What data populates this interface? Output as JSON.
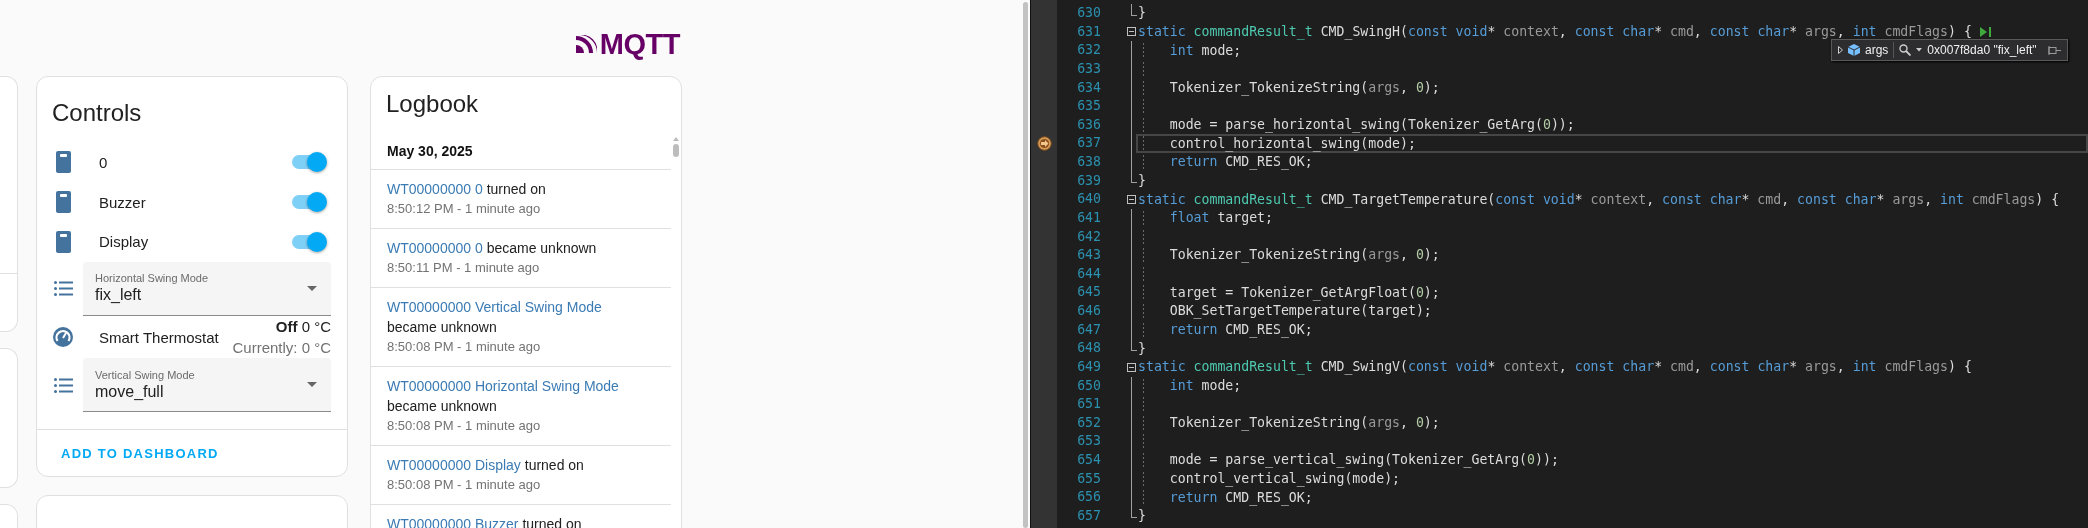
{
  "logo": {
    "text": "MQTT"
  },
  "controls": {
    "title": "Controls",
    "rows": [
      {
        "kind": "switch",
        "name": "0",
        "on": true
      },
      {
        "kind": "switch",
        "name": "Buzzer",
        "on": true
      },
      {
        "kind": "switch",
        "name": "Display",
        "on": true
      },
      {
        "kind": "select",
        "label": "Horizontal Swing Mode",
        "value": "fix_left"
      },
      {
        "kind": "climate",
        "name": "Smart Thermostat",
        "state": "**Off** 0 °C",
        "current": "Currently: 0 °C"
      },
      {
        "kind": "select",
        "label": "Vertical Swing Mode",
        "value": "move_full"
      }
    ],
    "action": "ADD TO DASHBOARD"
  },
  "logbook": {
    "title": "Logbook",
    "date": "May 30, 2025",
    "entries": [
      {
        "entity": "WT00000000 0",
        "action": "turned on",
        "time": "8:50:12 PM - 1 minute ago"
      },
      {
        "entity": "WT00000000 0",
        "action": "became unknown",
        "time": "8:50:11 PM - 1 minute ago"
      },
      {
        "entity": "WT00000000 Vertical Swing Mode",
        "action": "became unknown",
        "time": "8:50:08 PM - 1 minute ago"
      },
      {
        "entity": "WT00000000 Horizontal Swing Mode",
        "action": "became unknown",
        "time": "8:50:08 PM - 1 minute ago"
      },
      {
        "entity": "WT00000000 Display",
        "action": "turned on",
        "time": "8:50:08 PM - 1 minute ago"
      },
      {
        "entity": "WT00000000 Buzzer",
        "action": "turned on"
      }
    ]
  },
  "editor": {
    "datatip": {
      "name": "args",
      "value": "0x007f8da0 \"fix_left\""
    },
    "lines": [
      {
        "number": "630",
        "kind": "close",
        "current": false,
        "run_to_click": false,
        "tokens": [
          {
            "kind": "plain",
            "text": "}"
          }
        ]
      },
      {
        "number": "631",
        "kind": "open",
        "current": false,
        "run_to_click": true,
        "tokens": [
          {
            "kind": "keyword",
            "text": "static "
          },
          {
            "kind": "type",
            "text": "commandResult_t "
          },
          {
            "kind": "plain",
            "text": "CMD_SwingH("
          },
          {
            "kind": "keyword",
            "text": "const void"
          },
          {
            "kind": "plain",
            "text": "* "
          },
          {
            "kind": "param",
            "text": "context"
          },
          {
            "kind": "plain",
            "text": ", "
          },
          {
            "kind": "keyword",
            "text": "const char"
          },
          {
            "kind": "plain",
            "text": "* "
          },
          {
            "kind": "param",
            "text": "cmd"
          },
          {
            "kind": "plain",
            "text": ", "
          },
          {
            "kind": "keyword",
            "text": "const char"
          },
          {
            "kind": "plain",
            "text": "* "
          },
          {
            "kind": "param",
            "text": "args"
          },
          {
            "kind": "plain",
            "text": ", "
          },
          {
            "kind": "keyword",
            "text": "int "
          },
          {
            "kind": "param",
            "text": "cmdFlags"
          },
          {
            "kind": "plain",
            "text": ") {"
          }
        ]
      },
      {
        "number": "632",
        "kind": "body",
        "current": false,
        "run_to_click": false,
        "tokens": [
          {
            "kind": "keyword",
            "text": "    int "
          },
          {
            "kind": "plain",
            "text": "mode;"
          }
        ]
      },
      {
        "number": "633",
        "kind": "body",
        "current": false,
        "run_to_click": false
      },
      {
        "number": "634",
        "kind": "body",
        "current": false,
        "run_to_click": false,
        "tokens": [
          {
            "kind": "plain",
            "text": "    Tokenizer_TokenizeString("
          },
          {
            "kind": "param",
            "text": "args"
          },
          {
            "kind": "plain",
            "text": ", "
          },
          {
            "kind": "number",
            "text": "0"
          },
          {
            "kind": "plain",
            "text": ");"
          }
        ]
      },
      {
        "number": "635",
        "kind": "body",
        "current": false,
        "run_to_click": false
      },
      {
        "number": "636",
        "kind": "body",
        "current": false,
        "run_to_click": false,
        "tokens": [
          {
            "kind": "plain",
            "text": "    mode = parse_horizontal_swing(Tokenizer_GetArg("
          },
          {
            "kind": "number",
            "text": "0"
          },
          {
            "kind": "plain",
            "text": "));"
          }
        ]
      },
      {
        "number": "637",
        "kind": "body",
        "current": true,
        "run_to_click": false,
        "tokens": [
          {
            "kind": "plain",
            "text": "    control_horizontal_swing(mode);"
          }
        ]
      },
      {
        "number": "638",
        "kind": "body",
        "current": false,
        "run_to_click": false,
        "tokens": [
          {
            "kind": "keyword",
            "text": "    return "
          },
          {
            "kind": "plain",
            "text": "CMD_RES_OK;"
          }
        ]
      },
      {
        "number": "639",
        "kind": "close",
        "current": false,
        "run_to_click": false,
        "tokens": [
          {
            "kind": "plain",
            "text": "}"
          }
        ]
      },
      {
        "number": "640",
        "kind": "open",
        "current": false,
        "run_to_click": false,
        "tokens": [
          {
            "kind": "keyword",
            "text": "static "
          },
          {
            "kind": "type",
            "text": "commandResult_t "
          },
          {
            "kind": "plain",
            "text": "CMD_TargetTemperature("
          },
          {
            "kind": "keyword",
            "text": "const void"
          },
          {
            "kind": "plain",
            "text": "* "
          },
          {
            "kind": "param",
            "text": "context"
          },
          {
            "kind": "plain",
            "text": ", "
          },
          {
            "kind": "keyword",
            "text": "const char"
          },
          {
            "kind": "plain",
            "text": "* "
          },
          {
            "kind": "param",
            "text": "cmd"
          },
          {
            "kind": "plain",
            "text": ", "
          },
          {
            "kind": "keyword",
            "text": "const char"
          },
          {
            "kind": "plain",
            "text": "* "
          },
          {
            "kind": "param",
            "text": "args"
          },
          {
            "kind": "plain",
            "text": ", "
          },
          {
            "kind": "keyword",
            "text": "int "
          },
          {
            "kind": "param",
            "text": "cmdFlags"
          },
          {
            "kind": "plain",
            "text": ") {"
          }
        ]
      },
      {
        "number": "641",
        "kind": "body",
        "current": false,
        "run_to_click": false,
        "tokens": [
          {
            "kind": "keyword",
            "text": "    float "
          },
          {
            "kind": "plain",
            "text": "target;"
          }
        ]
      },
      {
        "number": "642",
        "kind": "body",
        "current": false,
        "run_to_click": false
      },
      {
        "number": "643",
        "kind": "body",
        "current": false,
        "run_to_click": false,
        "tokens": [
          {
            "kind": "plain",
            "text": "    Tokenizer_TokenizeString("
          },
          {
            "kind": "param",
            "text": "args"
          },
          {
            "kind": "plain",
            "text": ", "
          },
          {
            "kind": "number",
            "text": "0"
          },
          {
            "kind": "plain",
            "text": ");"
          }
        ]
      },
      {
        "number": "644",
        "kind": "body",
        "current": false,
        "run_to_click": false
      },
      {
        "number": "645",
        "kind": "body",
        "current": false,
        "run_to_click": false,
        "tokens": [
          {
            "kind": "plain",
            "text": "    target = Tokenizer_GetArgFloat("
          },
          {
            "kind": "number",
            "text": "0"
          },
          {
            "kind": "plain",
            "text": ");"
          }
        ]
      },
      {
        "number": "646",
        "kind": "body",
        "current": false,
        "run_to_click": false,
        "tokens": [
          {
            "kind": "plain",
            "text": "    OBK_SetTargetTemperature(target);"
          }
        ]
      },
      {
        "number": "647",
        "kind": "body",
        "current": false,
        "run_to_click": false,
        "tokens": [
          {
            "kind": "keyword",
            "text": "    return "
          },
          {
            "kind": "plain",
            "text": "CMD_RES_OK;"
          }
        ]
      },
      {
        "number": "648",
        "kind": "close",
        "current": false,
        "run_to_click": false,
        "tokens": [
          {
            "kind": "plain",
            "text": "}"
          }
        ]
      },
      {
        "number": "649",
        "kind": "open",
        "current": false,
        "run_to_click": false,
        "tokens": [
          {
            "kind": "keyword",
            "text": "static "
          },
          {
            "kind": "type",
            "text": "commandResult_t "
          },
          {
            "kind": "plain",
            "text": "CMD_SwingV("
          },
          {
            "kind": "keyword",
            "text": "const void"
          },
          {
            "kind": "plain",
            "text": "* "
          },
          {
            "kind": "param",
            "text": "context"
          },
          {
            "kind": "plain",
            "text": ", "
          },
          {
            "kind": "keyword",
            "text": "const char"
          },
          {
            "kind": "plain",
            "text": "* "
          },
          {
            "kind": "param",
            "text": "cmd"
          },
          {
            "kind": "plain",
            "text": ", "
          },
          {
            "kind": "keyword",
            "text": "const char"
          },
          {
            "kind": "plain",
            "text": "* "
          },
          {
            "kind": "param",
            "text": "args"
          },
          {
            "kind": "plain",
            "text": ", "
          },
          {
            "kind": "keyword",
            "text": "int "
          },
          {
            "kind": "param",
            "text": "cmdFlags"
          },
          {
            "kind": "plain",
            "text": ") {"
          }
        ]
      },
      {
        "number": "650",
        "kind": "body",
        "current": false,
        "run_to_click": false,
        "tokens": [
          {
            "kind": "keyword",
            "text": "    int "
          },
          {
            "kind": "plain",
            "text": "mode;"
          }
        ]
      },
      {
        "number": "651",
        "kind": "body",
        "current": false,
        "run_to_click": false
      },
      {
        "number": "652",
        "kind": "body",
        "current": false,
        "run_to_click": false,
        "tokens": [
          {
            "kind": "plain",
            "text": "    Tokenizer_TokenizeString("
          },
          {
            "kind": "param",
            "text": "args"
          },
          {
            "kind": "plain",
            "text": ", "
          },
          {
            "kind": "number",
            "text": "0"
          },
          {
            "kind": "plain",
            "text": ");"
          }
        ]
      },
      {
        "number": "653",
        "kind": "body",
        "current": false,
        "run_to_click": false
      },
      {
        "number": "654",
        "kind": "body",
        "current": false,
        "run_to_click": false,
        "tokens": [
          {
            "kind": "plain",
            "text": "    mode = parse_vertical_swing(Tokenizer_GetArg("
          },
          {
            "kind": "number",
            "text": "0"
          },
          {
            "kind": "plain",
            "text": "));"
          }
        ]
      },
      {
        "number": "655",
        "kind": "body",
        "current": false,
        "run_to_click": false,
        "tokens": [
          {
            "kind": "plain",
            "text": "    control_vertical_swing(mode);"
          }
        ]
      },
      {
        "number": "656",
        "kind": "body",
        "current": false,
        "run_to_click": false,
        "tokens": [
          {
            "kind": "keyword",
            "text": "    return "
          },
          {
            "kind": "plain",
            "text": "CMD_RES_OK;"
          }
        ]
      },
      {
        "number": "657",
        "kind": "close",
        "current": false,
        "run_to_click": false,
        "tokens": [
          {
            "kind": "plain",
            "text": "}"
          }
        ]
      }
    ]
  }
}
